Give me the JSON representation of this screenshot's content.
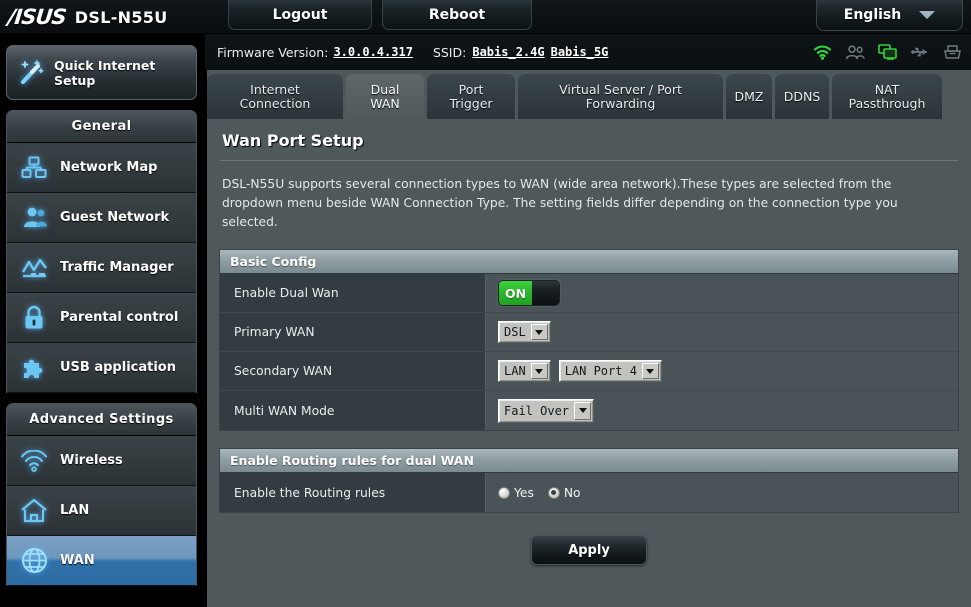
{
  "header": {
    "brand": "/ISUS",
    "model": "DSL-N55U",
    "logout_label": "Logout",
    "reboot_label": "Reboot",
    "language": "English"
  },
  "infobar": {
    "firmware_label": "Firmware Version:",
    "firmware_value": "3.0.0.4.317",
    "ssid_label": "SSID:",
    "ssid_1": "Babis_2.4G",
    "ssid_2": "Babis_5G",
    "icons": [
      "wifi-icon",
      "guest-network-icon",
      "network-clients-icon",
      "usb-icon",
      "printer-icon"
    ]
  },
  "sidebar": {
    "quick_setup": "Quick Internet Setup",
    "groups": [
      {
        "title": "General",
        "items": [
          {
            "label": "Network Map",
            "icon": "network-map-icon",
            "active": false
          },
          {
            "label": "Guest Network",
            "icon": "guest-network-icon",
            "active": false
          },
          {
            "label": "Traffic Manager",
            "icon": "traffic-manager-icon",
            "active": false
          },
          {
            "label": "Parental control",
            "icon": "lock-icon",
            "active": false
          },
          {
            "label": "USB application",
            "icon": "puzzle-icon",
            "active": false
          }
        ]
      },
      {
        "title": "Advanced Settings",
        "items": [
          {
            "label": "Wireless",
            "icon": "wireless-icon",
            "active": false
          },
          {
            "label": "LAN",
            "icon": "home-icon",
            "active": false
          },
          {
            "label": "WAN",
            "icon": "globe-icon",
            "active": true
          }
        ]
      }
    ]
  },
  "tabs": [
    {
      "label": "Internet Connection",
      "active": false
    },
    {
      "label": "Dual WAN",
      "active": true
    },
    {
      "label": "Port Trigger",
      "active": false
    },
    {
      "label": "Virtual Server / Port Forwarding",
      "active": false
    },
    {
      "label": "DMZ",
      "active": false
    },
    {
      "label": "DDNS",
      "active": false
    },
    {
      "label": "NAT Passthrough",
      "active": false
    }
  ],
  "page": {
    "title": "Wan Port Setup",
    "description": "DSL-N55U supports several connection types to WAN (wide area network).These types are selected from the dropdown menu beside WAN Connection Type. The setting fields differ depending on the connection type you selected."
  },
  "basic_config": {
    "section_title": "Basic Config",
    "enable_dual_wan": {
      "label": "Enable Dual Wan",
      "state": "ON"
    },
    "primary_wan": {
      "label": "Primary WAN",
      "value": "DSL"
    },
    "secondary_wan": {
      "label": "Secondary WAN",
      "value": "LAN",
      "port_value": "LAN Port 4"
    },
    "multi_wan_mode": {
      "label": "Multi WAN Mode",
      "value": "Fail Over"
    }
  },
  "routing_rules": {
    "section_title": "Enable Routing rules for dual WAN",
    "label": "Enable the Routing rules",
    "yes_label": "Yes",
    "no_label": "No",
    "selected": "No"
  },
  "actions": {
    "apply_label": "Apply"
  },
  "colors": {
    "accent_blue": "#2d6ca3",
    "toggle_green": "#2bb62b",
    "panel_bg": "#4f585b",
    "section_head": "#8e9da2"
  }
}
